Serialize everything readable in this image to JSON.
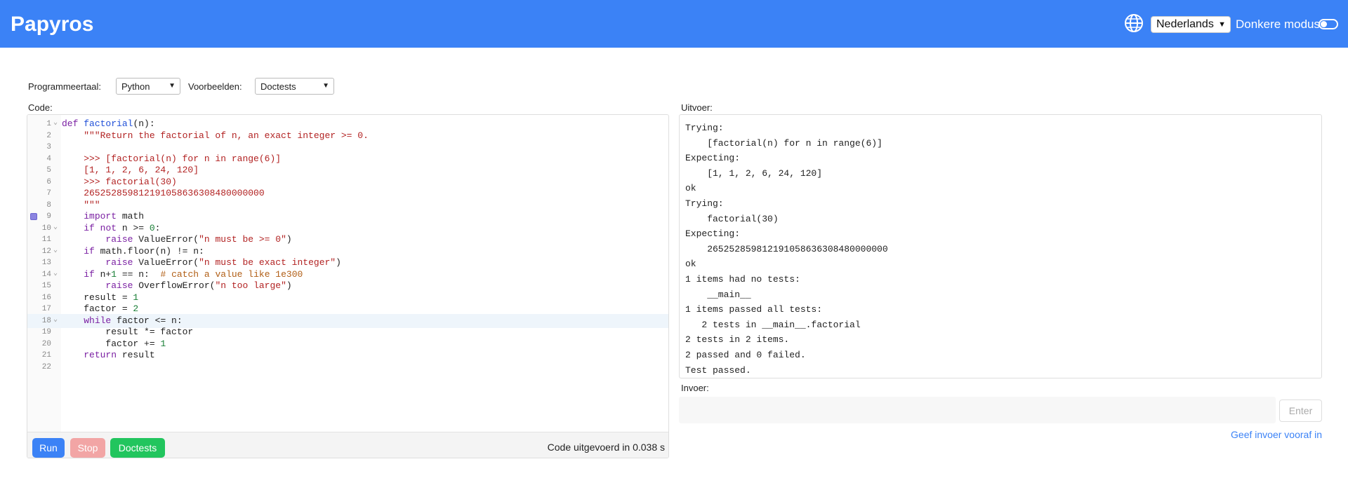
{
  "header": {
    "brand": "Papyros",
    "language": "Nederlands",
    "dark_mode_label": "Donkere modus",
    "accent_color": "#3b82f6"
  },
  "toolbar": {
    "programming_language_label": "Programmeertaal:",
    "programming_language_value": "Python",
    "examples_label": "Voorbeelden:",
    "examples_value": "Doctests"
  },
  "editor": {
    "label": "Code:",
    "lines": [
      "def factorial(n):",
      "    \"\"\"Return the factorial of n, an exact integer >= 0.",
      "",
      "    >>> [factorial(n) for n in range(6)]",
      "    [1, 1, 2, 6, 24, 120]",
      "    >>> factorial(30)",
      "    265252859812191058636308480000000",
      "    \"\"\"",
      "    import math",
      "    if not n >= 0:",
      "        raise ValueError(\"n must be >= 0\")",
      "    if math.floor(n) != n:",
      "        raise ValueError(\"n must be exact integer\")",
      "    if n+1 == n:  # catch a value like 1e300",
      "        raise OverflowError(\"n too large\")",
      "    result = 1",
      "    factor = 2",
      "    while factor <= n:",
      "        result *= factor",
      "        factor += 1",
      "    return result",
      ""
    ],
    "line_numbers": [
      "1",
      "2",
      "3",
      "4",
      "5",
      "6",
      "7",
      "8",
      "9",
      "10",
      "11",
      "12",
      "13",
      "14",
      "15",
      "16",
      "17",
      "18",
      "19",
      "20",
      "21",
      "22"
    ],
    "active_line": 18,
    "breakpoint_line": 9,
    "fold_lines": [
      1,
      10,
      12,
      14,
      18
    ],
    "buttons": {
      "run": "Run",
      "stop": "Stop",
      "doctests": "Doctests"
    },
    "button_colors": {
      "run": "#3b82f6",
      "stop": "#f2a5a5",
      "doctests": "#22c55e"
    },
    "status": "Code uitgevoerd in 0.038 s"
  },
  "output": {
    "label": "Uitvoer:",
    "lines": [
      "Trying:",
      "    [factorial(n) for n in range(6)]",
      "Expecting:",
      "    [1, 1, 2, 6, 24, 120]",
      "ok",
      "Trying:",
      "    factorial(30)",
      "Expecting:",
      "    265252859812191058636308480000000",
      "ok",
      "1 items had no tests:",
      "    __main__",
      "1 items passed all tests:",
      "   2 tests in __main__.factorial",
      "2 tests in 2 items.",
      "2 passed and 0 failed.",
      "Test passed."
    ]
  },
  "input": {
    "label": "Invoer:",
    "value": "",
    "enter_label": "Enter",
    "prefill_link": "Geef invoer vooraf in"
  }
}
